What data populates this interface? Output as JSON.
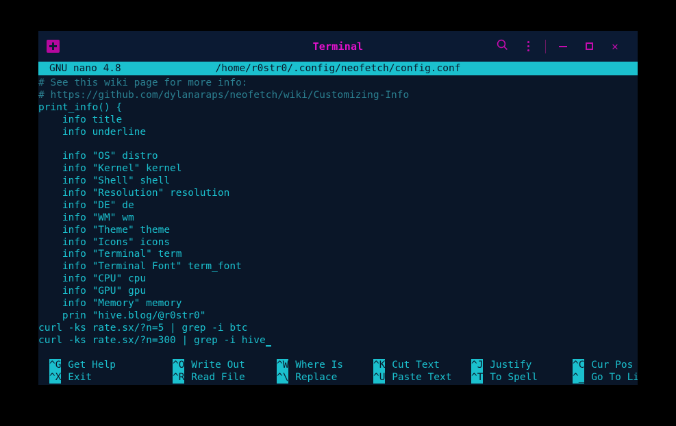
{
  "window": {
    "title": "Terminal",
    "titlebar": {
      "new_tab_icon": "new-tab-plus-icon",
      "search_icon": "search-icon",
      "menu_icon": "kebab-menu-icon",
      "minimize_icon": "minimize-icon",
      "maximize_icon": "maximize-icon",
      "close_icon": "close-icon",
      "close_glyph": "✕"
    }
  },
  "colors": {
    "desktop_bg": "#000000",
    "window_bg": "#0a1628",
    "titlebar_bg": "#0b1a33",
    "accent_magenta": "#c40cae",
    "title_magenta": "#e511cd",
    "accent_cyan": "#1bc0ce",
    "comment_teal": "#2b7f90"
  },
  "nano": {
    "version": "GNU nano 4.8",
    "filepath": "/home/r0str0/.config/neofetch/config.conf"
  },
  "editor": {
    "lines": [
      {
        "type": "comment",
        "text": "# See this wiki page for more info:"
      },
      {
        "type": "comment",
        "text": "# https://github.com/dylanaraps/neofetch/wiki/Customizing-Info"
      },
      {
        "type": "code",
        "text": "print_info() {"
      },
      {
        "type": "code",
        "text": "    info title"
      },
      {
        "type": "code",
        "text": "    info underline"
      },
      {
        "type": "code",
        "text": ""
      },
      {
        "type": "code",
        "text": "    info \"OS\" distro"
      },
      {
        "type": "code",
        "text": "    info \"Kernel\" kernel"
      },
      {
        "type": "code",
        "text": "    info \"Shell\" shell"
      },
      {
        "type": "code",
        "text": "    info \"Resolution\" resolution"
      },
      {
        "type": "code",
        "text": "    info \"DE\" de"
      },
      {
        "type": "code",
        "text": "    info \"WM\" wm"
      },
      {
        "type": "code",
        "text": "    info \"Theme\" theme"
      },
      {
        "type": "code",
        "text": "    info \"Icons\" icons"
      },
      {
        "type": "code",
        "text": "    info \"Terminal\" term"
      },
      {
        "type": "code",
        "text": "    info \"Terminal Font\" term_font"
      },
      {
        "type": "code",
        "text": "    info \"CPU\" cpu"
      },
      {
        "type": "code",
        "text": "    info \"GPU\" gpu"
      },
      {
        "type": "code",
        "text": "    info \"Memory\" memory"
      },
      {
        "type": "code",
        "text": "    prin \"hive.blog/@r0str0\""
      },
      {
        "type": "code",
        "text": "curl -ks rate.sx/?n=5 | grep -i btc"
      },
      {
        "type": "code",
        "text": "curl -ks rate.sx/?n=300 | grep -i hive",
        "cursor": true
      }
    ]
  },
  "shortcuts": {
    "row1": [
      {
        "key": "^G",
        "label": "Get Help"
      },
      {
        "key": "^O",
        "label": "Write Out"
      },
      {
        "key": "^W",
        "label": "Where Is"
      },
      {
        "key": "^K",
        "label": "Cut Text"
      },
      {
        "key": "^J",
        "label": "Justify"
      },
      {
        "key": "^C",
        "label": "Cur Pos"
      }
    ],
    "row2": [
      {
        "key": "^X",
        "label": "Exit"
      },
      {
        "key": "^R",
        "label": "Read File"
      },
      {
        "key": "^\\",
        "label": "Replace"
      },
      {
        "key": "^U",
        "label": "Paste Text"
      },
      {
        "key": "^T",
        "label": "To Spell"
      },
      {
        "key": "^_",
        "label": "Go To Line"
      }
    ]
  }
}
